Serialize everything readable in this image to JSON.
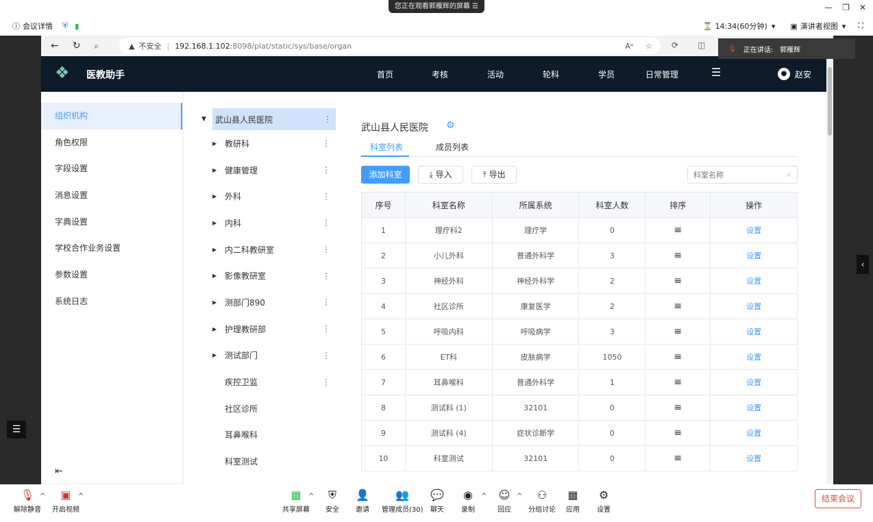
{
  "banner": "您正在观看郭雁辉的屏幕",
  "meeting": {
    "info": "会议详情",
    "timer": "14:34(60分钟)",
    "view": "演讲者视图"
  },
  "browser": {
    "insecure": "不安全",
    "url_host": "192.168.1.102",
    "url_path": ":8098/plat/static/sys/base/organ"
  },
  "speaker": {
    "label": "正在讲话:",
    "name": "郭雁辉"
  },
  "app": {
    "title": "医教助手",
    "nav": [
      "首页",
      "考核",
      "活动",
      "轮科",
      "学员",
      "日常管理"
    ],
    "user": "赵安"
  },
  "sidebar": {
    "items": [
      "组织机构",
      "角色权限",
      "字段设置",
      "消息设置",
      "字典设置",
      "学校合作业务设置",
      "参数设置",
      "系统日志"
    ]
  },
  "tree": {
    "root": "武山县人民医院",
    "items": [
      {
        "label": "教研科",
        "arrow": true,
        "dots": true
      },
      {
        "label": "健康管理",
        "arrow": true,
        "dots": true
      },
      {
        "label": "外科",
        "arrow": true,
        "dots": true
      },
      {
        "label": "内科",
        "arrow": true,
        "dots": true
      },
      {
        "label": "内二科教研室",
        "arrow": true,
        "dots": true
      },
      {
        "label": "影像教研室",
        "arrow": true,
        "dots": true
      },
      {
        "label": "测部门890",
        "arrow": true,
        "dots": true
      },
      {
        "label": "护理教研部",
        "arrow": true,
        "dots": true
      },
      {
        "label": "测试部门",
        "arrow": true,
        "dots": true
      },
      {
        "label": "疾控卫监",
        "arrow": false,
        "dots": true
      },
      {
        "label": "社区诊所",
        "arrow": false,
        "dots": false
      },
      {
        "label": "耳鼻喉科",
        "arrow": false,
        "dots": false
      },
      {
        "label": "科室测试",
        "arrow": false,
        "dots": false
      }
    ]
  },
  "main": {
    "title": "武山县人民医院",
    "tabs": [
      "科室列表",
      "成员列表"
    ],
    "add_btn": "添加科室",
    "import_btn": "导入",
    "export_btn": "导出",
    "search_placeholder": "科室名称",
    "headers": [
      "序号",
      "科室名称",
      "所属系统",
      "科室人数",
      "排序",
      "操作"
    ],
    "rows": [
      [
        "1",
        "理疗科2",
        "理疗学",
        "0",
        "设置"
      ],
      [
        "2",
        "小儿外科",
        "普通外科学",
        "3",
        "设置"
      ],
      [
        "3",
        "神经外科",
        "神经外科学",
        "2",
        "设置"
      ],
      [
        "4",
        "社区诊所",
        "康复医学",
        "2",
        "设置"
      ],
      [
        "5",
        "呼吸内科",
        "呼吸病学",
        "3",
        "设置"
      ],
      [
        "6",
        "ET科",
        "皮肤病学",
        "1050",
        "设置"
      ],
      [
        "7",
        "耳鼻喉科",
        "普通外科学",
        "1",
        "设置"
      ],
      [
        "8",
        "测试科 (1)",
        "32101",
        "0",
        "设置"
      ],
      [
        "9",
        "测试科 (4)",
        "症状诊断学",
        "0",
        "设置"
      ],
      [
        "10",
        "科室测试",
        "32101",
        "0",
        "设置"
      ]
    ]
  },
  "toolbar": {
    "items": [
      "解除静音",
      "开启视频",
      "共享屏幕",
      "安全",
      "邀请",
      "管理成员(30)",
      "聊天",
      "录制",
      "回应",
      "分组讨论",
      "应用",
      "设置"
    ],
    "end": "结束会议"
  },
  "colors": {
    "accent": "#409eff",
    "nav_bg": "#0d1b2a",
    "end_red": "#e0453a"
  }
}
